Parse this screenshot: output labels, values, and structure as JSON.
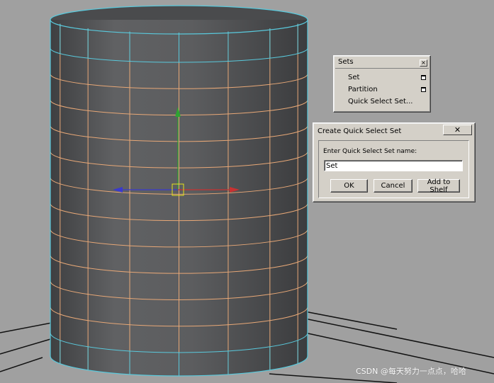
{
  "sets_menu": {
    "title": "Sets",
    "items": [
      {
        "label": "Set",
        "has_options": true
      },
      {
        "label": "Partition",
        "has_options": true
      },
      {
        "label": "Quick Select Set...",
        "has_options": false
      }
    ]
  },
  "dialog": {
    "title": "Create Quick Select Set",
    "prompt": "Enter Quick Select Set name:",
    "name_value": "Set",
    "ok_label": "OK",
    "cancel_label": "Cancel",
    "add_shelf_label": "Add to Shelf"
  },
  "watermark": "CSDN @每天努力一点点，哈哈",
  "colors": {
    "background": "#a0a0a0",
    "cylinder": "#5e5f61",
    "wire_selected": "#e8a877",
    "wire_border": "#59c9dc",
    "axis_x": "#c83232",
    "axis_y": "#2fa332",
    "axis_z": "#3a3acc",
    "pivot": "#e3e31a"
  }
}
